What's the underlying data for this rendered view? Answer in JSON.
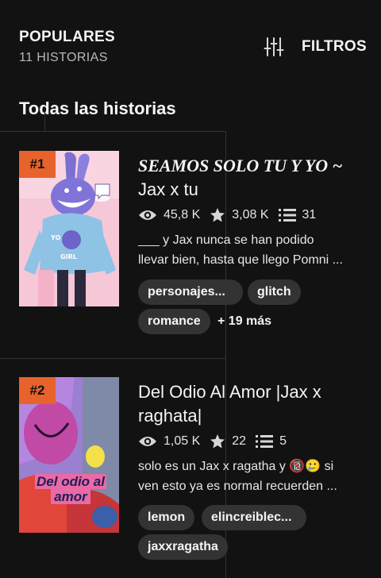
{
  "header": {
    "title": "POPULARES",
    "subtitle": "11 HISTORIAS",
    "filters_label": "FILTROS",
    "filters_icon": "sliders-icon"
  },
  "section_title": "Todas las historias",
  "colors": {
    "background": "#121212",
    "rank_badge": "#e8622c",
    "tag_bg": "#333333"
  },
  "stories": [
    {
      "rank": "#1",
      "title_line1": "SEAMOS SOLO TU Y YO ~",
      "title_line2": "Jax x tu",
      "views": "45,8 K",
      "votes": "3,08 K",
      "parts": "31",
      "desc_line1": "___ y Jax nunca se han podido",
      "desc_line2": "llevar bien, hasta que llego Pomni ...",
      "tags": [
        "personajes...",
        "glitch",
        "romance"
      ],
      "more_tags": "+ 19 más"
    },
    {
      "rank": "#2",
      "title_line1": "Del Odio Al Amor |Jax x",
      "title_line2": "raghata|",
      "views": "1,05 K",
      "votes": "22",
      "parts": "5",
      "desc_line1": "solo es un Jax x ragatha y 🔞🥲 si",
      "desc_line2": "ven esto ya es normal recuerden ...",
      "cover_text_line1": "Del odio al",
      "cover_text_line2": "amor",
      "tags": [
        "lemon",
        "elincreiblec...",
        "jaxxragatha"
      ]
    }
  ]
}
